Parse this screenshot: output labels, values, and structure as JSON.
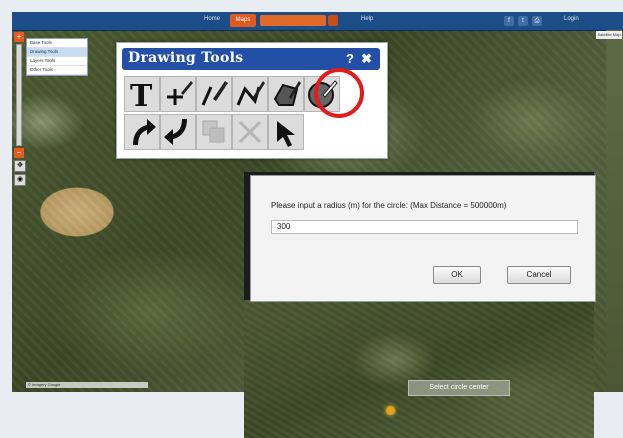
{
  "topbar": {
    "nav": [
      "Home",
      "Maps",
      "Help",
      "Login"
    ],
    "search_placeholder": "",
    "social": [
      "f",
      "t",
      "print"
    ]
  },
  "layers": {
    "items": [
      "Base Tools",
      "Drawing Tools",
      "Layers Tools",
      "Other Tools"
    ],
    "selected_index": 1
  },
  "map_type_label": "Satellite Map",
  "scale_text": "© Imagery Google",
  "drawing_tools": {
    "title": "Drawing Tools",
    "help": "?",
    "close": "✖",
    "tools_row1": [
      "text-tool",
      "point-tool",
      "line-tool",
      "polyline-tool",
      "polygon-tool",
      "circle-tool"
    ],
    "tools_row2": [
      "undo-tool",
      "redo-tool",
      "duplicate-tool",
      "delete-tool",
      "select-tool"
    ],
    "highlighted_tool": "circle-tool",
    "highlight_color": "#e21b1b"
  },
  "dialog": {
    "message": "Please input a radius (m) for the circle: (Max Distance = 500000m)",
    "value": "300",
    "ok": "OK",
    "cancel": "Cancel"
  },
  "map_tip": "Select circle center",
  "colors": {
    "topbar": "#1d4d86",
    "accent": "#e05a20",
    "tool_header": "#2350a6"
  }
}
